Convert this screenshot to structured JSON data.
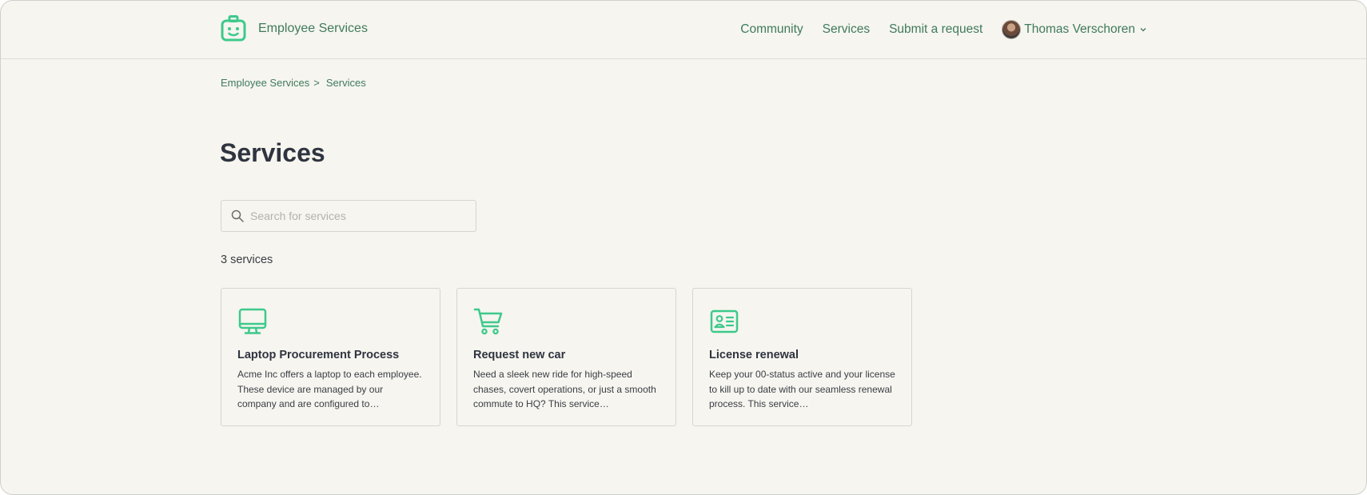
{
  "header": {
    "brand_name": "Employee Services",
    "nav": {
      "community": "Community",
      "services": "Services",
      "submit_request": "Submit a request"
    },
    "user": {
      "name": "Thomas Verschoren"
    }
  },
  "breadcrumb": {
    "home": "Employee Services",
    "separator": ">",
    "current": "Services"
  },
  "page": {
    "title": "Services",
    "search_placeholder": "Search for services",
    "count_label": "3 services"
  },
  "cards": [
    {
      "icon": "monitor-icon",
      "title": "Laptop Procurement Process",
      "description": "Acme Inc offers a laptop to each employee. These device are managed by our company and are configured to…"
    },
    {
      "icon": "shopping-cart-icon",
      "title": "Request new car",
      "description": "Need a sleek new ride for high-speed chases, covert operations, or just a smooth commute to HQ? This service…"
    },
    {
      "icon": "id-card-icon",
      "title": "License renewal",
      "description": "Keep your 00-status active and your license to kill up to date with our seamless renewal process. This service…"
    }
  ],
  "colors": {
    "background": "#f6f5ef",
    "accent_green": "#3f7a5d",
    "icon_green": "#3dc98c",
    "heading": "#2f3440"
  }
}
